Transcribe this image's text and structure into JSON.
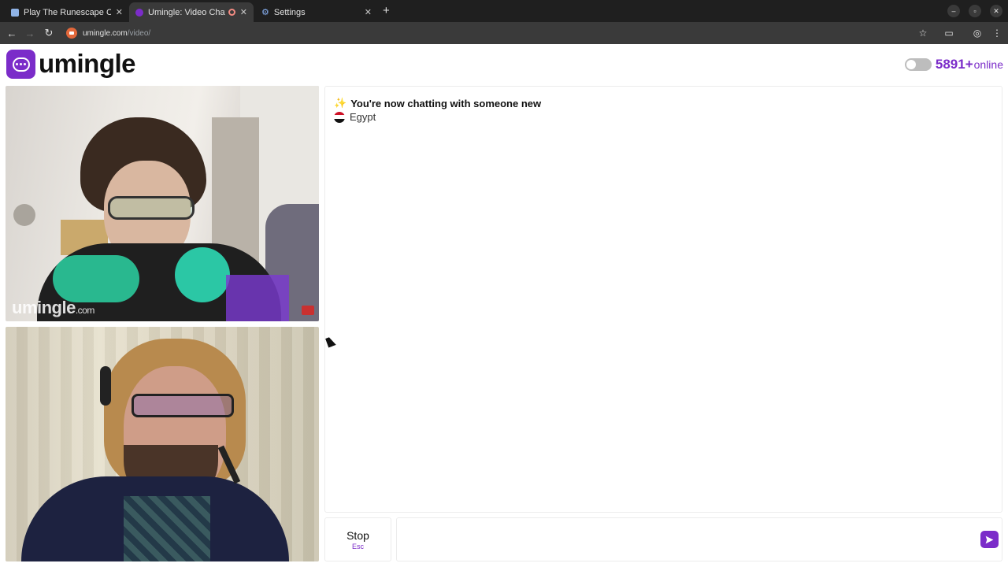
{
  "browser": {
    "tabs": [
      {
        "title": "Play The Runescape Cra",
        "icon": "runescape-favicon"
      },
      {
        "title": "Umingle: Video Chat",
        "icon": "umingle-favicon",
        "recording": true
      },
      {
        "title": "Settings",
        "icon": "settings-gear-icon"
      }
    ],
    "url_host": "umingle.com",
    "url_path": "/video/"
  },
  "header": {
    "logo_text": "umingle",
    "online_count": "5891+",
    "online_label": "online"
  },
  "video": {
    "watermark": "umingle",
    "watermark_suffix": ".com"
  },
  "chat": {
    "status_message": "You're now chatting with someone new",
    "country": "Egypt",
    "input_value": ""
  },
  "controls": {
    "stop_label": "Stop",
    "stop_hint": "Esc"
  },
  "colors": {
    "brand": "#7b2cc9",
    "chrome_dark": "#1f1f1f",
    "chrome_toolbar": "#3a3a3a"
  }
}
